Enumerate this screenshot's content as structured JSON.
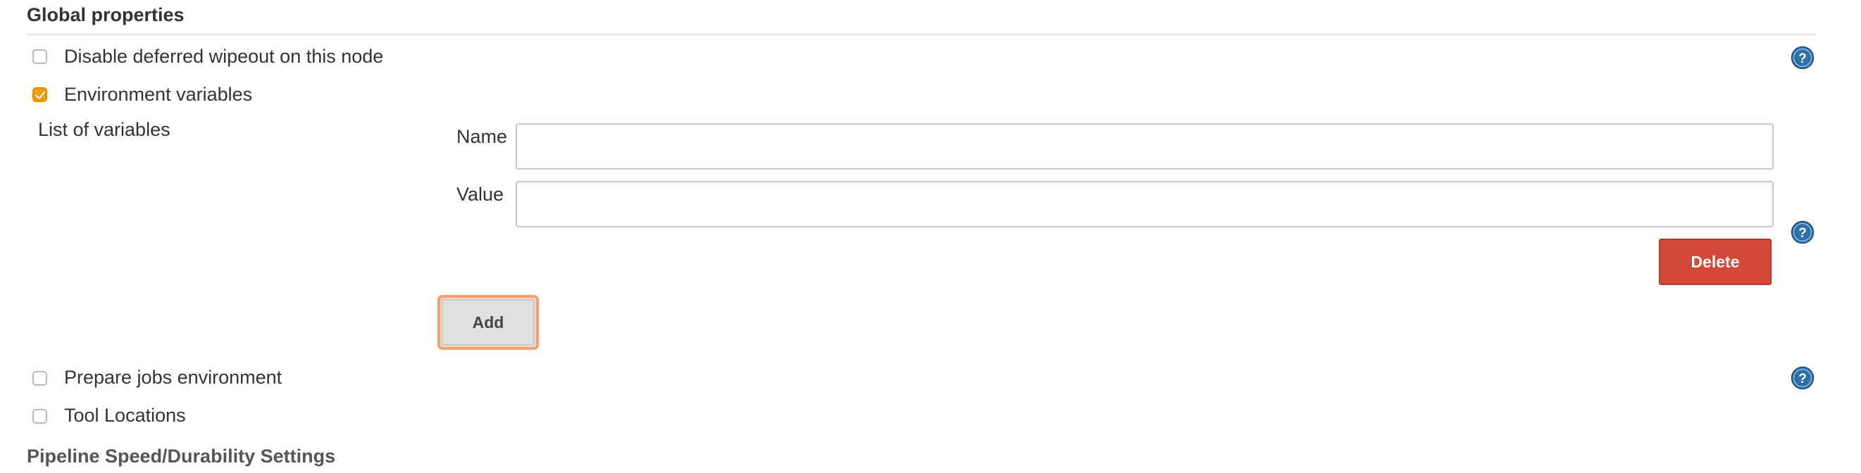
{
  "section": {
    "title": "Global properties"
  },
  "options": {
    "disable_wipeout": {
      "label": "Disable deferred wipeout on this node",
      "checked": false
    },
    "env_vars": {
      "label": "Environment variables",
      "checked": true
    },
    "prepare_jobs": {
      "label": "Prepare jobs environment",
      "checked": false
    },
    "tool_locations": {
      "label": "Tool Locations",
      "checked": false
    }
  },
  "env_list": {
    "label": "List of variables",
    "name_label": "Name",
    "name_value": "",
    "value_label": "Value",
    "value_value": "",
    "delete_label": "Delete",
    "add_label": "Add"
  },
  "next_section": {
    "title": "Pipeline Speed/Durability Settings"
  },
  "icons": {
    "help": "help-icon",
    "checkmark": "checkmark-icon"
  },
  "colors": {
    "checkbox_checked": "#f39c12",
    "delete_button": "#d24939",
    "add_focus_ring": "#f5a070",
    "help_icon": "#2f6fa8"
  }
}
